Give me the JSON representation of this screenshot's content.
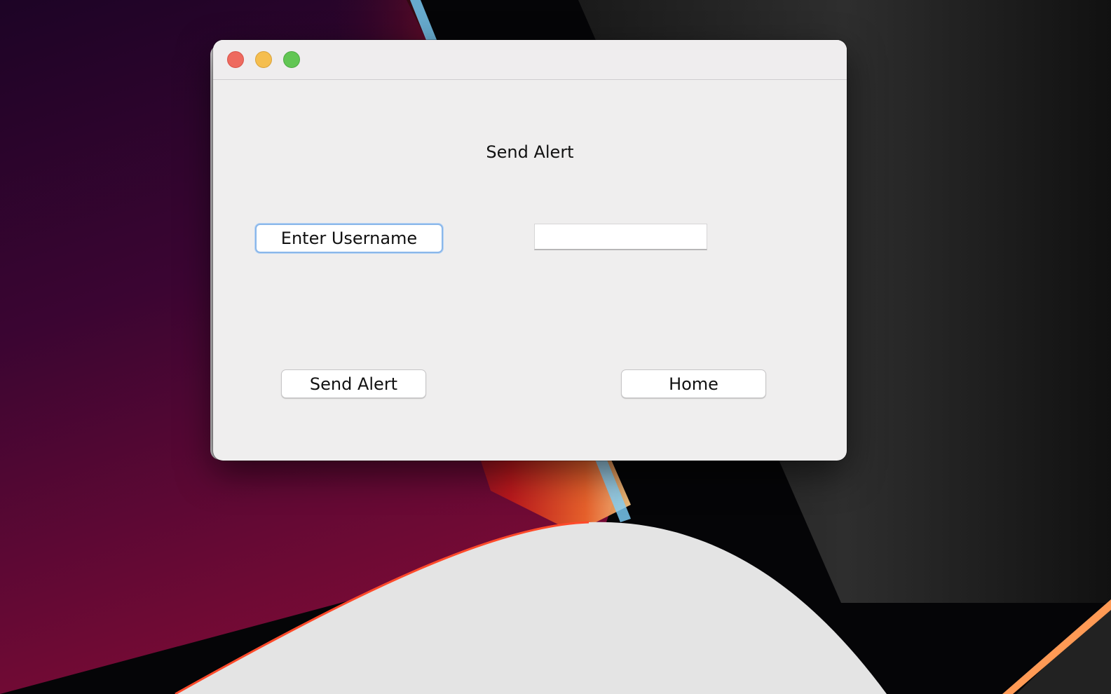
{
  "window": {
    "title": "Send Alert"
  },
  "form": {
    "username_label": "Enter Username",
    "username_value": ""
  },
  "actions": {
    "send_label": "Send Alert",
    "home_label": "Home"
  },
  "colors": {
    "close": "#ee6a5f",
    "minimize": "#f5be4f",
    "maximize": "#62c654",
    "focus_ring": "#8ab7ea"
  }
}
